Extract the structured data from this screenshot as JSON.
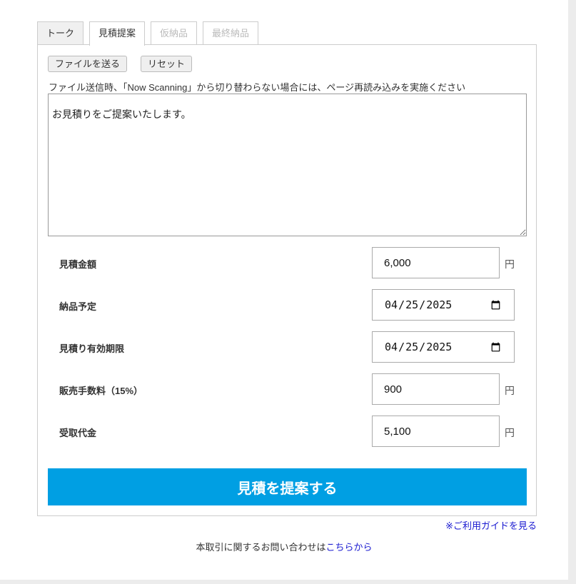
{
  "tabs": [
    "トーク",
    "見積提案",
    "仮納品",
    "最終納品"
  ],
  "buttons": {
    "send_file": "ファイルを送る",
    "reset": "リセット",
    "submit": "見積を提案する"
  },
  "note": "ファイル送信時、「Now Scanning」から切り替わらない場合には、ページ再読み込みを実施ください",
  "message": "お見積りをご提案いたします。",
  "fields": [
    {
      "label": "見積金額",
      "value": "6,000",
      "unit": "円"
    },
    {
      "label": "納品予定",
      "value": "2025-04-25"
    },
    {
      "label": "見積り有効期限",
      "value": "2025-04-25"
    },
    {
      "label": "販売手数料（15%）",
      "value": "900",
      "unit": "円"
    },
    {
      "label": "受取代金",
      "value": "5,100",
      "unit": "円"
    }
  ],
  "guide_link": "※ご利用ガイドを見る",
  "contact": {
    "text": "本取引に関するお問い合わせは",
    "link": "こちらから"
  }
}
